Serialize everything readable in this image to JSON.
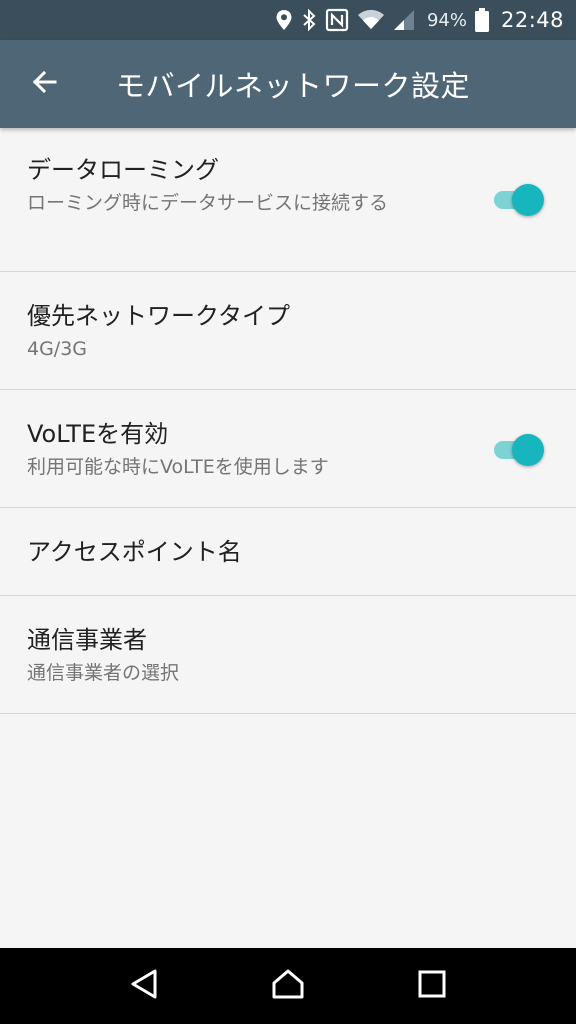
{
  "status_bar": {
    "battery_percent": "94%",
    "time": "22:48",
    "icons": [
      "location-icon",
      "bluetooth-icon",
      "nfc-icon",
      "wifi-icon",
      "cell-signal-icon",
      "battery-icon"
    ]
  },
  "app_bar": {
    "title": "モバイルネットワーク設定",
    "back_icon": "back-arrow-icon"
  },
  "settings": {
    "data_roaming": {
      "title": "データローミング",
      "subtitle": "ローミング時にデータサービスに接続する",
      "enabled": true
    },
    "preferred_network": {
      "title": "優先ネットワークタイプ",
      "subtitle": "4G/3G"
    },
    "volte": {
      "title": "VoLTEを有効",
      "subtitle": "利用可能な時にVoLTEを使用します",
      "enabled": true
    },
    "apn": {
      "title": "アクセスポイント名"
    },
    "carrier": {
      "title": "通信事業者",
      "subtitle": "通信事業者の選択"
    }
  },
  "colors": {
    "status_bar": "#3a4e5c",
    "app_bar": "#4f6677",
    "toggle_accent": "#17b6bf",
    "background": "#f5f5f5"
  },
  "nav_bar": {
    "icons": [
      "back-triangle-icon",
      "home-icon",
      "recents-square-icon"
    ]
  }
}
